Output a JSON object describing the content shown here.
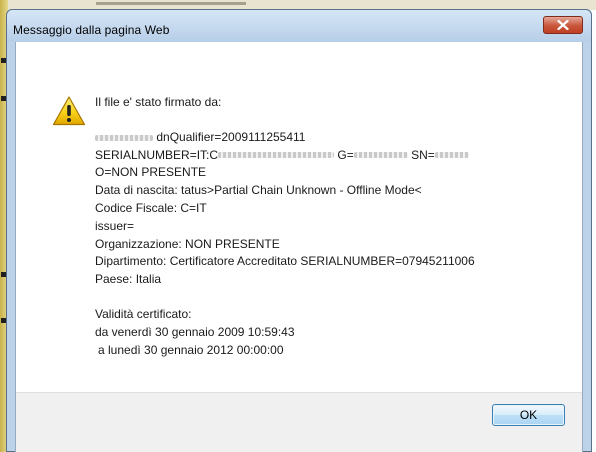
{
  "dialog": {
    "title": "Messaggio dalla pagina Web",
    "close_label": "×",
    "ok_label": "OK",
    "icon": "warning-triangle-icon",
    "accent": "#c8553b"
  },
  "message": {
    "intro": "Il file e' stato firmato da:",
    "dn_qualifier": "dnQualifier=2009111255411",
    "serial_prefix": "SERIALNUMBER=IT:C",
    "given_prefix": "G=",
    "surname_prefix": "SN=",
    "org_line": "O=NON PRESENTE",
    "birth_line": "Data di nascita: tatus>Partial Chain Unknown - Offline Mode<",
    "fiscal_line": "Codice Fiscale: C=IT",
    "issuer_line": "issuer=",
    "organization_line": "Organizzazione: NON PRESENTE",
    "department_line": "Dipartimento: Certificatore Accreditato SERIALNUMBER=07945211006",
    "country_line": "Paese: Italia",
    "validity_title": "Validità certificato:",
    "valid_from": "da venerdì 30 gennaio 2009 10:59:43",
    "valid_to": "a lunedì 30 gennaio 2012 00:00:00"
  }
}
